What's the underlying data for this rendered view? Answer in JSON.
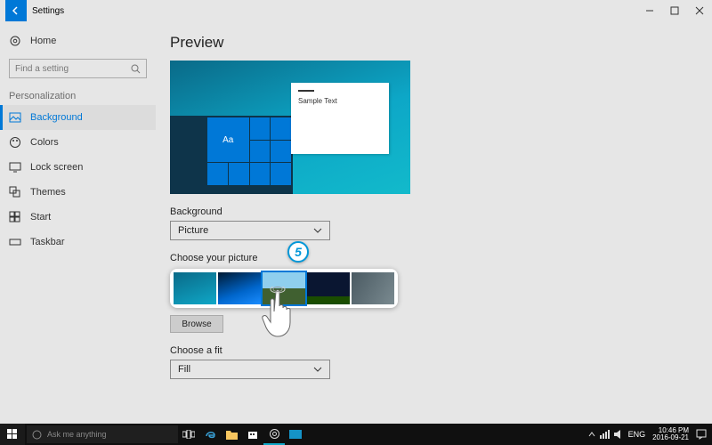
{
  "titlebar": {
    "title": "Settings"
  },
  "sidebar": {
    "home": "Home",
    "search_placeholder": "Find a setting",
    "category": "Personalization",
    "items": [
      {
        "label": "Background"
      },
      {
        "label": "Colors"
      },
      {
        "label": "Lock screen"
      },
      {
        "label": "Themes"
      },
      {
        "label": "Start"
      },
      {
        "label": "Taskbar"
      }
    ]
  },
  "main": {
    "preview_title": "Preview",
    "sample_text": "Sample Text",
    "background_label": "Background",
    "background_value": "Picture",
    "choose_picture_label": "Choose your picture",
    "browse_label": "Browse",
    "fit_label": "Choose a fit",
    "fit_value": "Fill",
    "preview_tile_text": "Aa"
  },
  "callout": {
    "number": "5"
  },
  "taskbar": {
    "search_placeholder": "Ask me anything",
    "lang": "ENG",
    "time": "10:46 PM",
    "date": "2016-09-21"
  }
}
